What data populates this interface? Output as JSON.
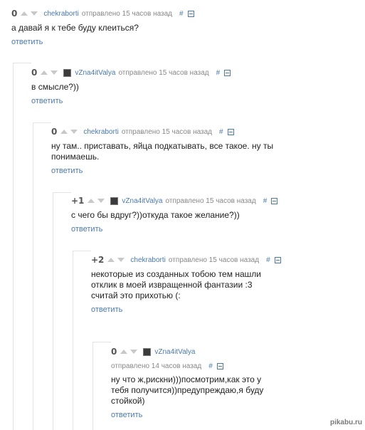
{
  "comments": [
    {
      "rating": "0",
      "author": "chekraborti",
      "posted": "отправлено 15 часов назад",
      "hash": "#",
      "text": "а давай я к тебе буду клеиться?",
      "reply": "ответить",
      "has_avatar": false
    },
    {
      "rating": "0",
      "author": "vZna4itValya",
      "posted": "отправлено 15 часов назад",
      "hash": "#",
      "text": "в смысле?))",
      "reply": "ответить",
      "has_avatar": true
    },
    {
      "rating": "0",
      "author": "chekraborti",
      "posted": "отправлено 15 часов назад",
      "hash": "#",
      "text": "ну там.. приставать, яйца подкатывать, все такое. ну ты понимаешь.",
      "reply": "ответить",
      "has_avatar": false
    },
    {
      "rating": "+1",
      "author": "vZna4itValya",
      "posted": "отправлено 15 часов назад",
      "hash": "#",
      "text": "с чего бы вдруг?))откуда такое желание?))",
      "reply": "ответить",
      "has_avatar": true
    },
    {
      "rating": "+2",
      "author": "chekraborti",
      "posted": "отправлено 15 часов назад",
      "hash": "#",
      "text": "некоторые из созданных тобою тем нашли отклик в моей извращенной фантазии :3 считай это прихотью (:",
      "reply": "ответить",
      "has_avatar": false
    },
    {
      "rating": "0",
      "author": "vZna4itValya",
      "posted": "отправлено 14 часов назад",
      "hash": "#",
      "text": "ну что ж,рискни)))посмотрим,как это у тебя получится))предупреждаю,я буду стойкой)",
      "reply": "ответить",
      "has_avatar": true
    }
  ],
  "watermark": "pikabu.ru"
}
